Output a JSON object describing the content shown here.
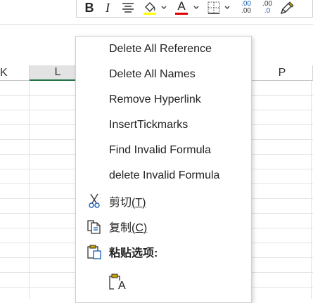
{
  "toolbar": {
    "bold_label": "B",
    "italic_label": "I",
    "font_color_label": "A",
    "increase_decimal_top": ".00",
    "increase_decimal_bottom": ".00",
    "decrease_decimal_top": ".00",
    "decrease_decimal_bottom": ".0",
    "fill_color": "#ffff00",
    "font_color": "#e00000"
  },
  "grid": {
    "columns": [
      "K",
      "L",
      "P"
    ],
    "selected_column": "L",
    "selection_color": "#217346"
  },
  "menu": {
    "items": [
      {
        "label": "Delete All Reference"
      },
      {
        "label": "Delete All Names"
      },
      {
        "label": "Remove Hyperlink"
      },
      {
        "label": "InsertTickmarks"
      },
      {
        "label": "Find Invalid Formula"
      },
      {
        "label": "delete Invalid Formula"
      }
    ],
    "cut": {
      "label": "剪切",
      "shortcut": "T",
      "icon": "scissors-icon"
    },
    "copy": {
      "label": "复制",
      "shortcut": "C",
      "icon": "copy-icon"
    },
    "paste_options": {
      "label": "粘贴选项:",
      "icon": "clipboard-icon"
    },
    "paste_keep_text": {
      "icon": "paste-text-only-icon",
      "glyph": "A"
    }
  }
}
